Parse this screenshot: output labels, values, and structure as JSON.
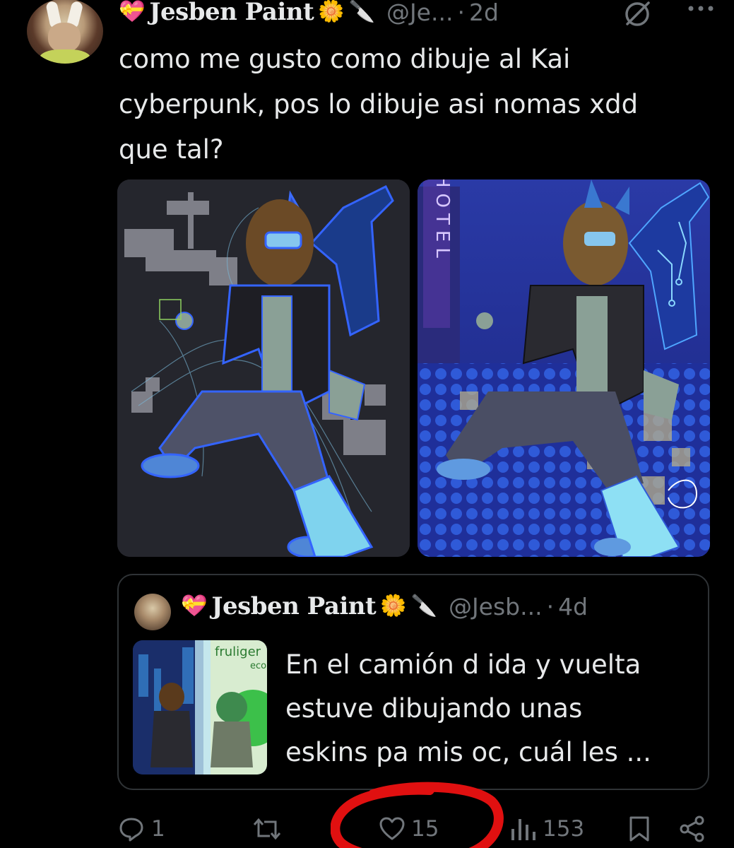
{
  "tweet": {
    "author_name": "Jesben Paint",
    "author_handle": "@Je...",
    "time_separator": "·",
    "time": "2d",
    "emoji_heart": "💝",
    "emoji_flower": "🌼",
    "emoji_knife": "🔪",
    "text_lines": [
      "como me gusto como dibuje al Kai",
      "cyberpunk, pos lo dibuje asi nomas xdd",
      "que tal?"
    ],
    "icons": {
      "grok": "grok-icon",
      "more": "more-icon"
    }
  },
  "media": {
    "left_image": "sketch-image",
    "right_image": "finished-artwork-image",
    "sign_text": "HOTEL"
  },
  "quote": {
    "author_name": "Jesben Paint",
    "author_handle": "@Jesb...",
    "time_separator": "·",
    "time": "4d",
    "emoji_heart": "💝",
    "emoji_flower": "🌼",
    "emoji_knife": "🔪",
    "thumb_label_1": "fruliger",
    "thumb_label_2": "eco",
    "text_lines": [
      "En el camión d ida y vuelta",
      "estuve dibujando unas",
      "eskins pa mis oc, cuál les ..."
    ]
  },
  "actions": {
    "replies": "1",
    "reposts": "",
    "likes": "15",
    "views": "153"
  },
  "colors": {
    "background": "#000000",
    "text": "#e7e9ea",
    "muted": "#71767b",
    "border": "#2f3336",
    "annotation": "#e01010"
  }
}
